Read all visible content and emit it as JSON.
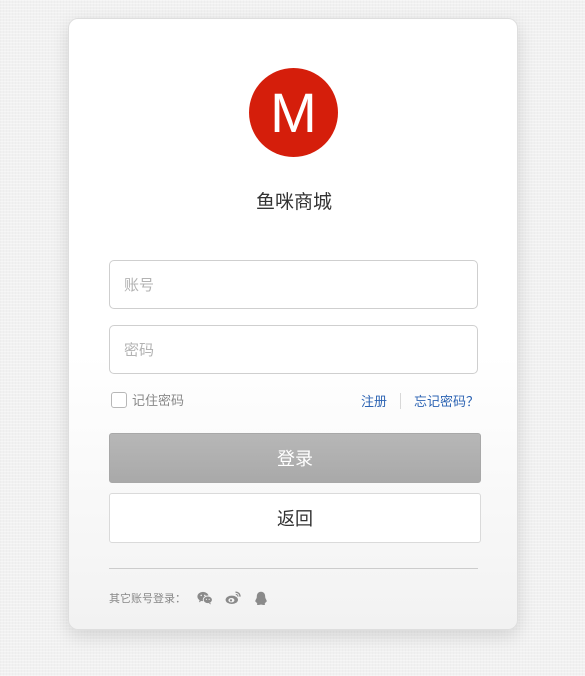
{
  "brand": {
    "logo_letter": "M",
    "logo_color": "#d51e0b",
    "name": "鱼咪商城"
  },
  "form": {
    "account_placeholder": "账号",
    "account_value": "",
    "password_placeholder": "密码",
    "password_value": "",
    "remember_label": "记住密码",
    "remember_checked": false,
    "register_link": "注册",
    "forgot_link": "忘记密码？"
  },
  "actions": {
    "login_label": "登录",
    "back_label": "返回"
  },
  "social": {
    "label": "其它账号登录：",
    "icons": [
      "wechat-icon",
      "weibo-icon",
      "qq-icon"
    ]
  },
  "colors": {
    "link": "#2d64b3",
    "login_button": "#b0b0b0"
  }
}
